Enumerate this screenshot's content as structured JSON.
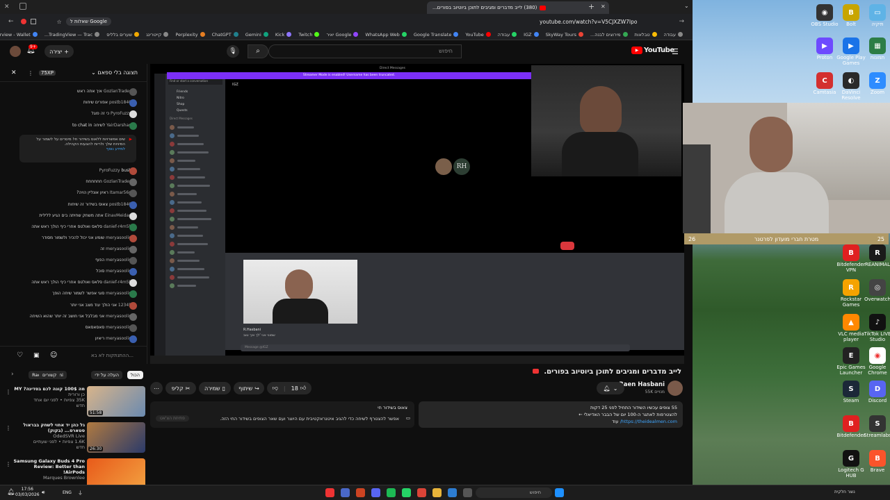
{
  "browser": {
    "active_tab_title": "(380) לייב מדברים ומגיבים לתוכן ביוטיוב בפורים...",
    "url": "youtube.com/watch?v=V5CJXZW7Ipo",
    "left_tab": "Google שאלות ל"
  },
  "bookmarks": [
    "עבודה",
    "טבלאות",
    "מירוצים לבנה...",
    "SkyWay Tours",
    "IGZ",
    "עבודה",
    "YouTube",
    "Google Translate",
    "WhatsApp Web",
    "Google יאיר",
    "Twitch",
    "Kick",
    "Gemini",
    "ChatGPT",
    "Perplexity",
    "קייטרינג",
    "שערים בלליס",
    "TradingView — Trac...",
    "Overview - Wallet ..."
  ],
  "youtube": {
    "logo": "YouTube",
    "search_placeholder": "חיפוש",
    "create_label": "יצירה",
    "notif_count": "9+"
  },
  "chat": {
    "header_label": "תצוגה בלי ספאם",
    "viewers": "75XP",
    "messages": [
      {
        "user": "@GozlanTrades",
        "text": "איך אתה ראש"
      },
      {
        "user": "@postb1840",
        "text": "אפורים שיחות"
      },
      {
        "user": "@PyroFuzzy",
        "text": "כי זה פוגל"
      },
      {
        "user": "@YairDarshan",
        "text": "לשיחה to chat in"
      },
      {
        "user": "@PyroFuzzy",
        "text": "bush"
      },
      {
        "user": "@GozlanTrades",
        "text": "חחחחחח"
      },
      {
        "user": "@Itamar56p",
        "text": "ראיון אונליין הויה?"
      },
      {
        "user": "@postb1840",
        "text": "צאוס בשידור זה שיחות"
      },
      {
        "user": "@EinavMeidan",
        "text": "אתה משחק שחיתה בים הגיע ללילית"
      },
      {
        "user": "@danief-r4m5k",
        "text": "סלאס ואולטס אחרי כיף הולך ראש אתה"
      },
      {
        "user": "@meryasoolin",
        "text": "שומע אני יכול להכיר ולשמור מסודר"
      },
      {
        "user": "@meryasoolin",
        "text": "זה"
      },
      {
        "user": "@meryasoolin",
        "text": "הפוף"
      },
      {
        "user": "@meryasoolin",
        "text": "סוכל"
      },
      {
        "user": "@danief-r4m5k",
        "text": "סלאס ואולטס אחרי כיף הולך ראש אתה"
      },
      {
        "user": "@meryasoolin",
        "text": "סוגי אפשר לשמור שיחה הופך"
      },
      {
        "user": "@12345",
        "text": "אני הולך עוד מצב אני יותר"
      },
      {
        "user": "@meryasoolin",
        "text": "אני מבלבל אני חושב זה יותר שהוא השיחה"
      },
      {
        "user": "@meryasoolin",
        "text": "סאסאסאס"
      },
      {
        "user": "@meryasoolin",
        "text": "ריאיון"
      }
    ],
    "pinned_text": "שים אפשרויות ללאוס בשידור חי! מיסרים על לשמור על המיניות שלך ולריות להצעות הקהילה.",
    "pinned_link": "למידע נוסף",
    "input_placeholder": "ההתנתקות לא בא...",
    "tabs": [
      "הכול",
      "העלה על ידי",
      "Raen Hasbani",
      "קשורים"
    ]
  },
  "stream": {
    "discord_banner": "Streamer Mode is enabled! Username has been truncated.",
    "direct_messages": "Direct Messages",
    "find_placeholder": "Find or start a conversation",
    "friends": "Friends",
    "nitro": "Nitro",
    "shop": "Shop",
    "quests": "Quests",
    "dm_header": "Direct Messages",
    "call_user": "IGZ",
    "avatar_initials": "RH",
    "message_user": "R.Hasbani",
    "message_text": "שמוני אני 'לך איך טוב",
    "input_placeholder": "Message @IGZ"
  },
  "overlay": {
    "banner_text": "מטרת חברי מועדון לפרטנר",
    "count_left": "26",
    "count_right": "25"
  },
  "video": {
    "title": "לייב מדברים ומגיבים לתוכן ביוטיוב בפורים.",
    "channel": "Raen Hasbani",
    "subscribers": "55K מנויים",
    "likes": "18",
    "share": "שיתוף",
    "save": "שמירה",
    "clip": "קליפ",
    "desc_line1": "55 צופים עכשיו  השידור התחיל לפני 25 דקות",
    "desc_line2": "להצטרפות לאתגר ה-100 יום של הבבר האדיאלי ←",
    "desc_link": "https://theidealmen.com/",
    "desc_more": "עוד",
    "chat_title": "צאוס בשידור חי",
    "chat_desc": "אפשר להצטרף לשיחה כדי להגיב איטנראקטיבית עם היוצר ועם שאר הצופים בשידור החי הזה.",
    "chat_button": "פתיחת הצ'אט"
  },
  "recommendations": [
    {
      "title": "מה 100$ קונה לכם בסדינה? MY",
      "channel": "כן ורורית",
      "meta": "35K צפיות • לפני יום אחד",
      "badge": "חדש",
      "duration": "51:58"
    },
    {
      "title": "גל כהן יד אחוי לשחק בבראול סטארס... (בקוק)",
      "channel": "OdedSVR Live",
      "meta": "1.6K צפיות • לפני שעתיים",
      "badge": "חדש",
      "duration": "26:30"
    },
    {
      "title": "Samsung Galaxy Buds 4 Pro Review: Better than AirPods!",
      "channel": "Marques Brownlee",
      "meta": "",
      "badge": "",
      "duration": ""
    }
  ],
  "desktop_icons": [
    {
      "label": "OBS Studio",
      "color": "#333333",
      "glyph": "◉"
    },
    {
      "label": "Bolt",
      "color": "#c8a500",
      "glyph": "B"
    },
    {
      "label": "תיקיה",
      "color": "#5fb3e6",
      "glyph": "▭"
    },
    {
      "label": "Proton",
      "color": "#6d4aff",
      "glyph": "▶"
    },
    {
      "label": "Google Play Games",
      "color": "#1a73e8",
      "glyph": "▶"
    },
    {
      "label": "תמונות",
      "color": "#2d7d46",
      "glyph": "▦"
    },
    {
      "label": "Camtasia",
      "color": "#d32f2f",
      "glyph": "C"
    },
    {
      "label": "DaVinci Resolve",
      "color": "#2a2a2a",
      "glyph": "◐"
    },
    {
      "label": "Zoom",
      "color": "#2d8cff",
      "glyph": "Z"
    },
    {
      "label": "Bitdefender VPN",
      "color": "#e02020",
      "glyph": "B"
    },
    {
      "label": "REANIMAL",
      "color": "#1a1a1a",
      "glyph": "R"
    },
    {
      "label": "Rockstar Games",
      "color": "#f5a300",
      "glyph": "R"
    },
    {
      "label": "Overwatch",
      "color": "#444444",
      "glyph": "◎"
    },
    {
      "label": "VLC media player",
      "color": "#ff8800",
      "glyph": "▲"
    },
    {
      "label": "TikTok LIVE Studio",
      "color": "#111111",
      "glyph": "♪"
    },
    {
      "label": "Epic Games Launcher",
      "color": "#222222",
      "glyph": "E"
    },
    {
      "label": "Google Chrome",
      "color": "#ffffff",
      "glyph": "◉"
    },
    {
      "label": "Steam",
      "color": "#1b2838",
      "glyph": "S"
    },
    {
      "label": "Discord",
      "color": "#5865f2",
      "glyph": "D"
    },
    {
      "label": "Bitdefender",
      "color": "#e02020",
      "glyph": "B"
    },
    {
      "label": "Streamlabs",
      "color": "#333333",
      "glyph": "S"
    },
    {
      "label": "Logitech G HUB",
      "color": "#111111",
      "glyph": "G"
    },
    {
      "label": "Brave",
      "color": "#fb542b",
      "glyph": "B"
    }
  ],
  "taskbar": {
    "time": "17:56",
    "date": "03/03/2026",
    "lang": "ENG",
    "search_placeholder": "חיפוש",
    "weather": "נוצר חלקית"
  }
}
